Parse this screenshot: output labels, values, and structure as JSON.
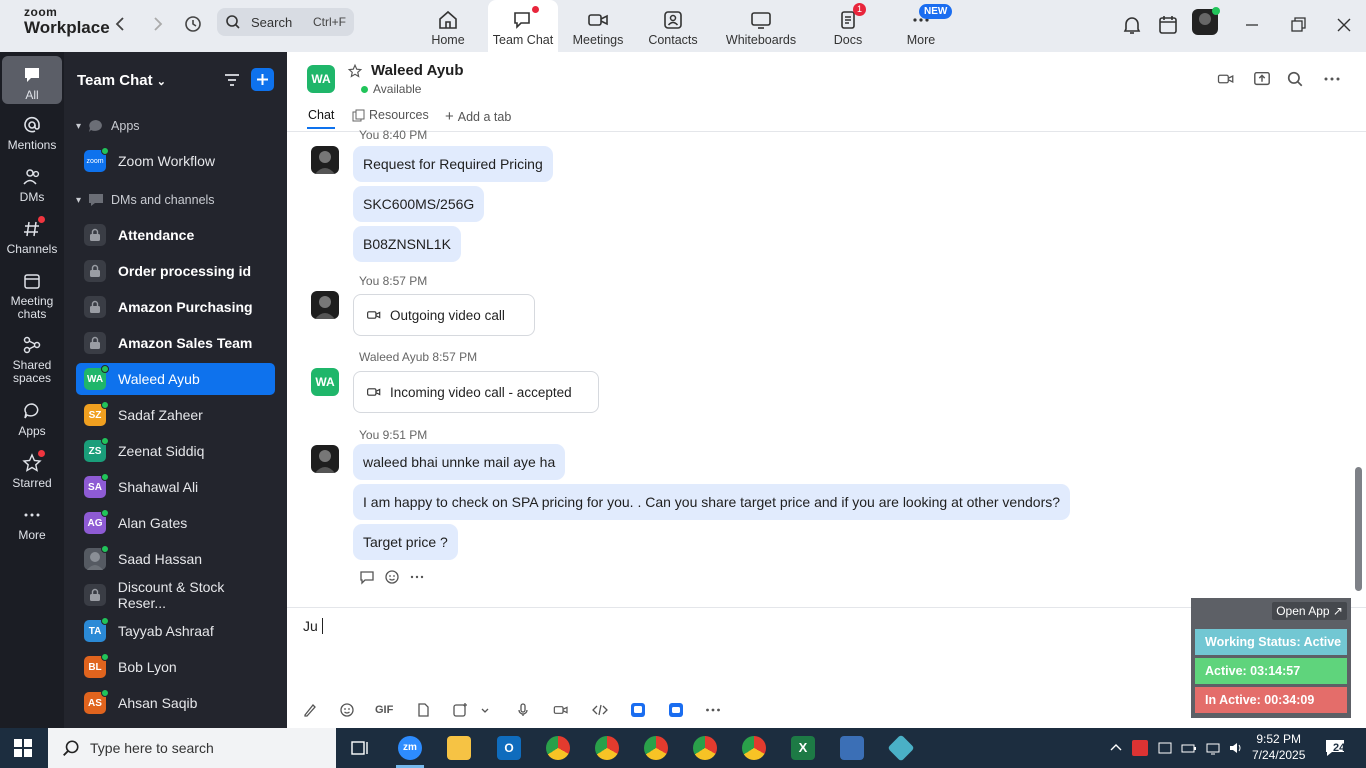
{
  "app": {
    "logo_line1": "zoom",
    "logo_line2": "Workplace"
  },
  "search": {
    "label": "Search",
    "shortcut": "Ctrl+F"
  },
  "nav": [
    {
      "label": "Home",
      "icon": "home-icon"
    },
    {
      "label": "Team Chat",
      "icon": "chat-icon",
      "active": true,
      "dot": true
    },
    {
      "label": "Meetings",
      "icon": "video-camera-icon"
    },
    {
      "label": "Contacts",
      "icon": "contacts-icon"
    },
    {
      "label": "Whiteboards",
      "icon": "whiteboard-icon"
    },
    {
      "label": "Docs",
      "icon": "docs-icon",
      "badge": "1"
    },
    {
      "label": "More",
      "icon": "more-dots-icon",
      "new": "NEW"
    }
  ],
  "rail": [
    {
      "label": "All",
      "active": true
    },
    {
      "label": "Mentions"
    },
    {
      "label": "DMs"
    },
    {
      "label": "Channels",
      "dot": true
    },
    {
      "label": "Meeting chats"
    },
    {
      "label": "Shared spaces"
    },
    {
      "label": "Apps"
    },
    {
      "label": "Starred",
      "dot": true
    },
    {
      "label": "More"
    }
  ],
  "sidebar": {
    "title": "Team Chat",
    "apps_section": "Apps",
    "app_item": "Zoom Workflow",
    "app_logo": "zoom",
    "dm_section": "DMs and channels",
    "channels": [
      "Attendance",
      "Order processing id",
      "Amazon Purchasing",
      "Amazon Sales Team"
    ],
    "contacts": [
      {
        "initials": "WA",
        "name": "Waleed Ayub",
        "color": "#1fb66a",
        "selected": true
      },
      {
        "initials": "SZ",
        "name": "Sadaf Zaheer",
        "color": "#f0a020"
      },
      {
        "initials": "ZS",
        "name": "Zeenat Siddiq",
        "color": "#1a9e7a"
      },
      {
        "initials": "SA",
        "name": "Shahawal Ali",
        "color": "#8e5bd4"
      },
      {
        "initials": "AG",
        "name": "Alan Gates",
        "color": "#8e5bd4"
      },
      {
        "initials": "",
        "name": "Saad Hassan",
        "color": "#555a62",
        "photo": true
      },
      {
        "initials": "",
        "name": "Discount & Stock Reser...",
        "lock": true
      },
      {
        "initials": "TA",
        "name": "Tayyab Ashraaf",
        "color": "#2b8ad6"
      },
      {
        "initials": "BL",
        "name": "Bob Lyon",
        "color": "#e0641e"
      },
      {
        "initials": "AS",
        "name": "Ahsan Saqib",
        "color": "#e0641e"
      }
    ]
  },
  "chat": {
    "header": {
      "initials": "WA",
      "name": "Waleed Ayub",
      "status": "Available"
    },
    "tabs": {
      "chat": "Chat",
      "resources": "Resources",
      "add": "Add a tab"
    },
    "messages": [
      {
        "meta": "You 8:40 PM",
        "lines": [
          "Request for Required Pricing",
          "SKC600MS/256G",
          "B08ZNSNL1K"
        ]
      },
      {
        "meta": "You 8:57 PM",
        "call": "Outgoing video call"
      },
      {
        "meta_name": "Waleed Ayub",
        "meta_time": "8:57 PM",
        "call": "Incoming video call - accepted"
      },
      {
        "meta": "You 9:51 PM",
        "lines": [
          "waleed bhai unnke mail aye ha",
          "I am happy to check on SPA pricing for you. . Can you share target price and if you are looking at other vendors?",
          "Target price ?"
        ]
      }
    ],
    "composer_text": "Ju",
    "gif_label": "GIF"
  },
  "widget": {
    "open_app": "Open App ↗",
    "working": "Working Status: Active",
    "active": "Active: 03:14:57",
    "inactive": "In Active: 00:34:09",
    "colors": {
      "working": "#72c7d3",
      "active": "#5fd47c",
      "inactive": "#e46d6a"
    }
  },
  "taskbar": {
    "search": "Type here to search",
    "time": "9:52 PM",
    "date": "7/24/2025",
    "notif": "24"
  }
}
